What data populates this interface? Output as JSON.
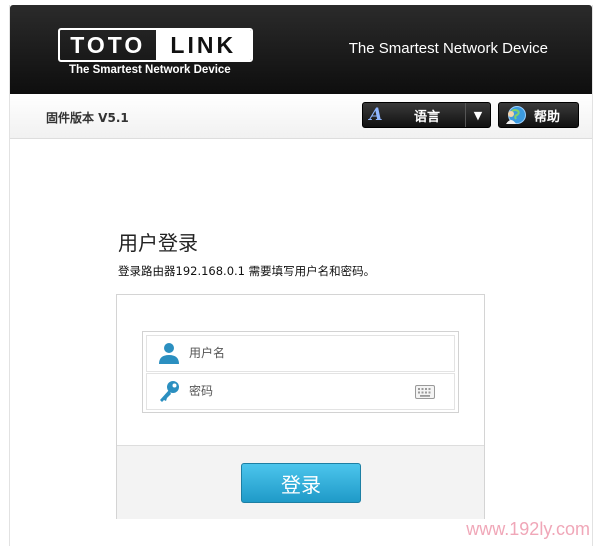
{
  "header": {
    "logo_left": "TOTO",
    "logo_right": "LINK",
    "logo_tagline": "The Smartest Network Device",
    "slogan": "The Smartest Network Device"
  },
  "toolbar": {
    "firmware": "固件版本 V5.1",
    "language_label": "语言",
    "language_icon_glyph": "A",
    "language_caret": "▼",
    "help_label": "帮助"
  },
  "login": {
    "title": "用户登录",
    "description": "登录路由器192.168.0.1 需要填写用户名和密码。",
    "username_placeholder": "用户名",
    "password_placeholder": "密码",
    "submit_label": "登录"
  },
  "watermark": "www.192ly.com",
  "colors": {
    "header_bg": "#1a1a1a",
    "button_blue": "#2aa6d6",
    "icon_blue": "#2b8fc0",
    "watermark": "#f0a7b8"
  },
  "icons": {
    "language": "font-a-icon",
    "help": "globe-person-icon",
    "username": "user-icon",
    "password": "key-icon",
    "keyboard": "keyboard-icon"
  }
}
